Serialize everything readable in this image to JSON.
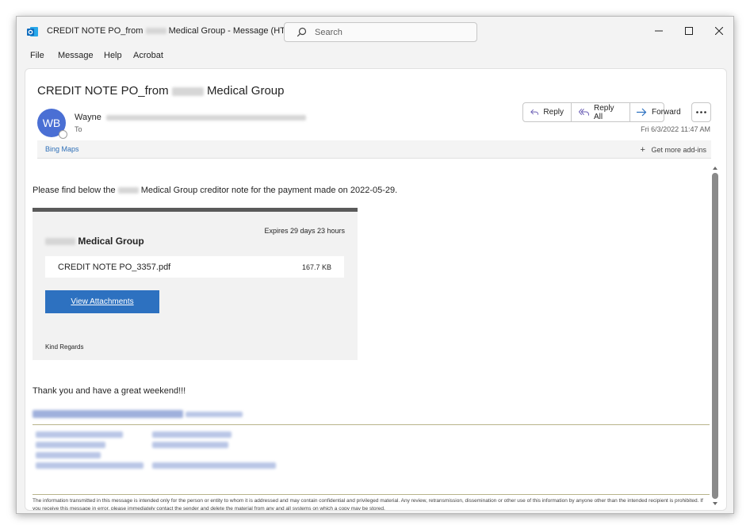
{
  "window": {
    "title_prefix": "CREDIT NOTE PO_from",
    "title_suffix": "Medical Group - Message (HTML)",
    "search_placeholder": "Search"
  },
  "menu": [
    "File",
    "Message",
    "Help",
    "Acrobat"
  ],
  "message": {
    "subject_prefix": "CREDIT NOTE PO_from",
    "subject_suffix": "Medical Group",
    "avatar_initials": "WB",
    "sender_first_name": "Wayne",
    "to_label": "To",
    "date": "Fri 6/3/2022 11:47 AM",
    "actions": {
      "reply": "Reply",
      "reply_all": "Reply All",
      "forward": "Forward"
    }
  },
  "addins": {
    "bing_maps": "Bing Maps",
    "get_more": "Get more add-ins"
  },
  "body": {
    "intro_prefix": "Please find below the",
    "intro_suffix": "Medical Group creditor note for the payment made on 2022-05-29.",
    "card": {
      "expires": "Expires 29 days 23 hours",
      "title": "Medical Group",
      "file_name": "CREDIT NOTE PO_3357.pdf",
      "file_size": "167.7 KB",
      "button": "View Attachments",
      "closing": "Kind Regards"
    },
    "thanks": "Thank you and have a great weekend!!!",
    "disclaimer": "The information transmitted in this message is intended only for the person or entity to whom it is addressed and may contain confidential and privileged material. Any review, retransmission, dissemination or other use of this information by anyone other than the intended recipient is prohibited. If you receive this message in error, please immediately contact the sender and delete the material from any and all systems on which a copy may be stored."
  },
  "colors": {
    "accent": "#2d71c0",
    "avatar": "#4a6fd4",
    "outlook_icon": "#0f6cbd"
  },
  "icons": [
    "outlook-icon",
    "search-icon",
    "minimize-icon",
    "maximize-icon",
    "close-icon",
    "reply-icon",
    "reply-all-icon",
    "forward-icon",
    "more-icon",
    "plus-icon",
    "scroll-up-icon",
    "scroll-down-icon"
  ]
}
